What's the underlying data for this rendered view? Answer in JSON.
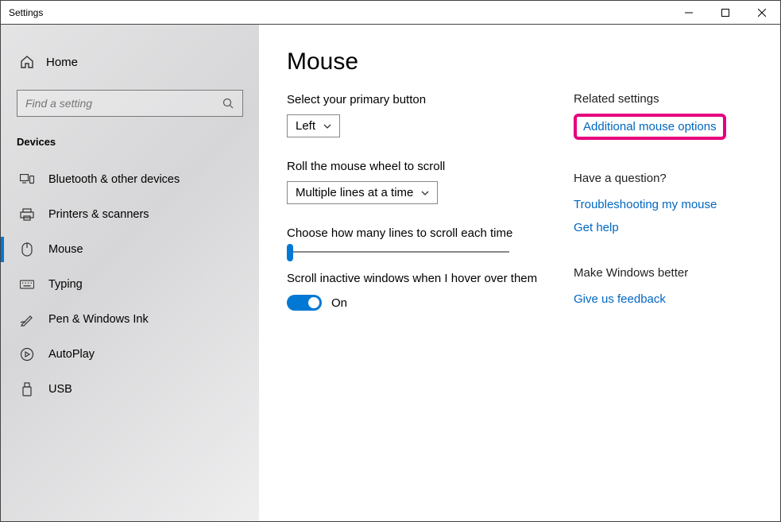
{
  "window": {
    "title": "Settings"
  },
  "sidebar": {
    "home": "Home",
    "search_placeholder": "Find a setting",
    "section": "Devices",
    "items": [
      {
        "label": "Bluetooth & other devices"
      },
      {
        "label": "Printers & scanners"
      },
      {
        "label": "Mouse"
      },
      {
        "label": "Typing"
      },
      {
        "label": "Pen & Windows Ink"
      },
      {
        "label": "AutoPlay"
      },
      {
        "label": "USB"
      }
    ]
  },
  "main": {
    "heading": "Mouse",
    "primary_label": "Select your primary button",
    "primary_value": "Left",
    "wheel_label": "Roll the mouse wheel to scroll",
    "wheel_value": "Multiple lines at a time",
    "lines_label": "Choose how many lines to scroll each time",
    "inactive_label": "Scroll inactive windows when I hover over them",
    "toggle_state": "On"
  },
  "aside": {
    "related_heading": "Related settings",
    "related_link": "Additional mouse options",
    "question_heading": "Have a question?",
    "question_links": [
      "Troubleshooting my mouse",
      "Get help"
    ],
    "feedback_heading": "Make Windows better",
    "feedback_link": "Give us feedback"
  }
}
